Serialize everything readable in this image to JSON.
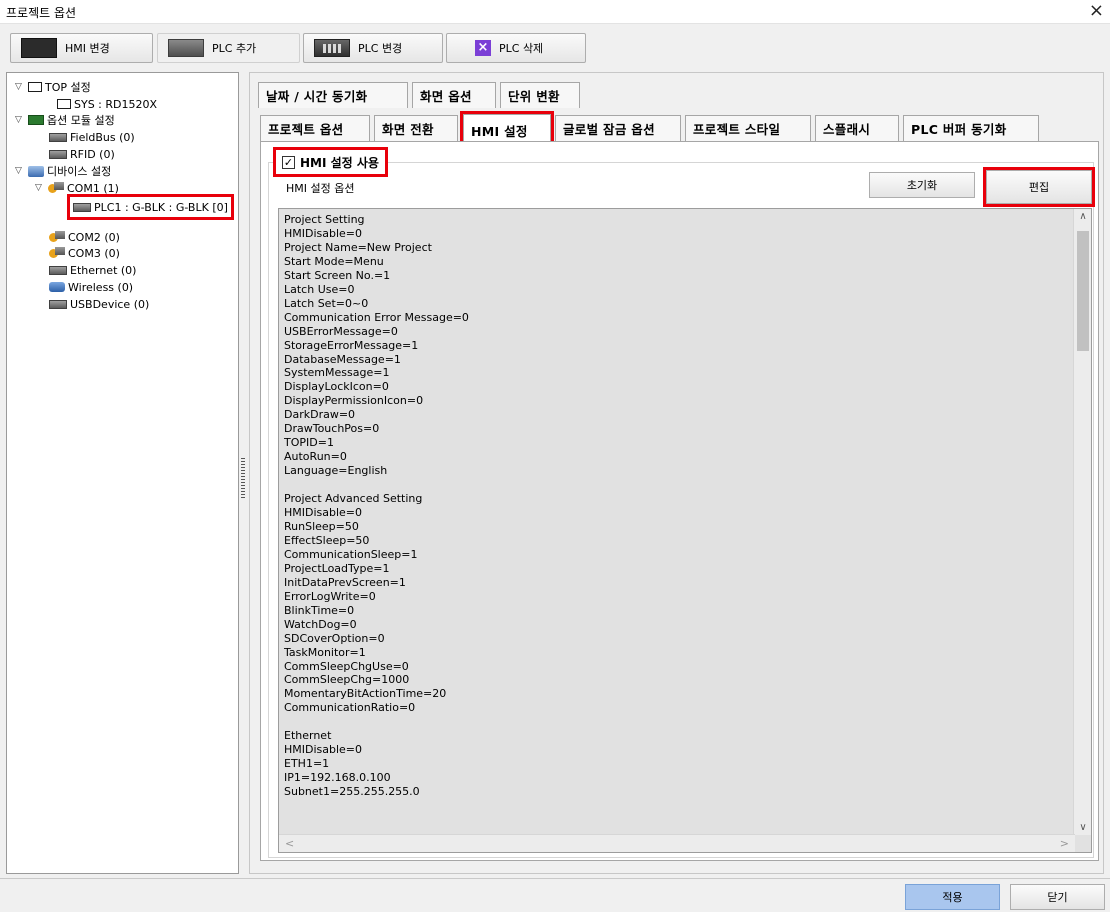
{
  "window": {
    "title": "프로젝트 옵션",
    "close_label": "×"
  },
  "toolbar": {
    "hmi_change": "HMI 변경",
    "plc_add": "PLC 추가",
    "plc_change": "PLC 변경",
    "plc_delete": "PLC 삭제"
  },
  "tree": {
    "top": "TOP 설정",
    "sys": "SYS : RD1520X",
    "option_module": "옵션 모듈 설정",
    "fieldbus": "FieldBus (0)",
    "rfid": "RFID (0)",
    "device": "디바이스 설정",
    "com1": "COM1 (1)",
    "plc1": "PLC1 : G-BLK : G-BLK [0]",
    "com2": "COM2 (0)",
    "com3": "COM3 (0)",
    "ethernet": "Ethernet (0)",
    "wireless": "Wireless (0)",
    "usbdevice": "USBDevice (0)"
  },
  "tabs_row1": [
    "날짜 / 시간 동기화",
    "화면 옵션",
    "단위 변환"
  ],
  "tabs_row2": [
    "프로젝트 옵션",
    "화면 전환",
    "HMI 설정",
    "글로벌 잠금 옵션",
    "프로젝트 스타일",
    "스플래시",
    "PLC 버퍼 동기화"
  ],
  "hmi": {
    "use_label": "HMI 설정 사용",
    "checked": true,
    "options_label": "HMI 설정 옵션",
    "reset_button": "초기화",
    "edit_button": "편집",
    "settings_text": "Project Setting\nHMIDisable=0\nProject Name=New Project\nStart Mode=Menu\nStart Screen No.=1\nLatch Use=0\nLatch Set=0~0\nCommunication Error Message=0\nUSBErrorMessage=0\nStorageErrorMessage=1\nDatabaseMessage=1\nSystemMessage=1\nDisplayLockIcon=0\nDisplayPermissionIcon=0\nDarkDraw=0\nDrawTouchPos=0\nTOPID=1\nAutoRun=0\nLanguage=English\n\nProject Advanced Setting\nHMIDisable=0\nRunSleep=50\nEffectSleep=50\nCommunicationSleep=1\nProjectLoadType=1\nInitDataPrevScreen=1\nErrorLogWrite=0\nBlinkTime=0\nWatchDog=0\nSDCoverOption=0\nTaskMonitor=1\nCommSleepChgUse=0\nCommSleepChg=1000\nMomentaryBitActionTime=20\nCommunicationRatio=0\n\nEthernet\nHMIDisable=0\nETH1=1\nIP1=192.168.0.100\nSubnet1=255.255.255.0"
  },
  "footer": {
    "apply_button": "적용",
    "close_button": "닫기"
  },
  "colors": {
    "highlight": "#e8000b",
    "apply_button": "#a9c6ee"
  }
}
